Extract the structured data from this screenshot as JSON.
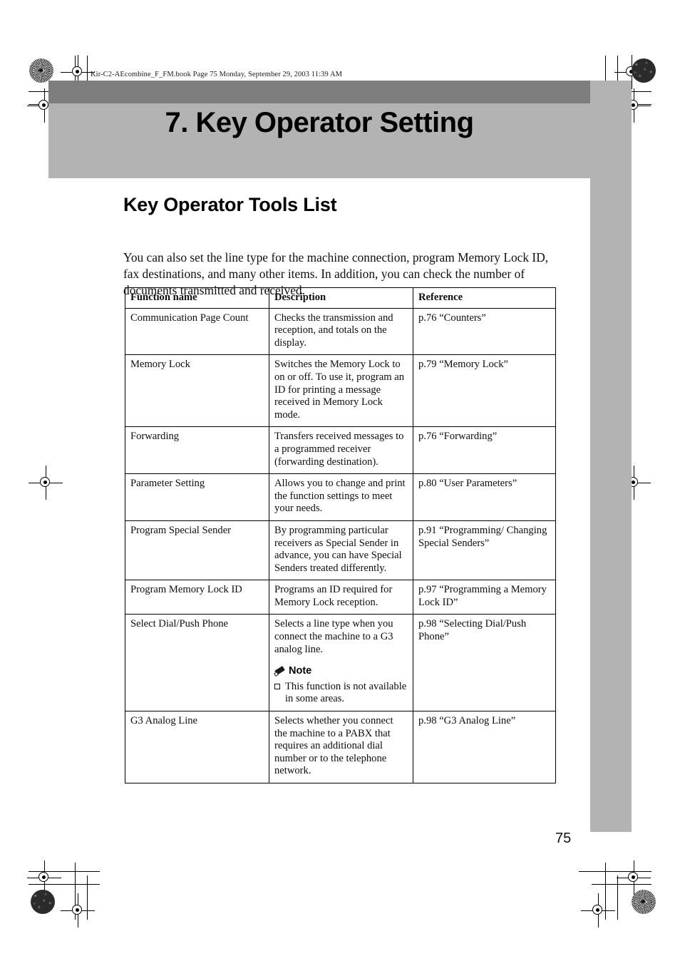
{
  "document": {
    "file_header": "Kir-C2-AEcombine_F_FM.book  Page 75  Monday, September 29, 2003  11:39 AM",
    "chapter_title": "7. Key Operator Setting",
    "section_title": "Key Operator Tools List",
    "intro_paragraph": "You can also set the line type for the machine connection, program Memory Lock ID, fax destinations, and many other items. In addition, you can check the number of documents transmitted and received.",
    "page_number": "75"
  },
  "table": {
    "headers": {
      "function_name": "Function name",
      "description": "Description",
      "reference": "Reference"
    },
    "rows": [
      {
        "function_name": "Communication Page Count",
        "description": "Checks the transmission and reception, and totals on the display.",
        "reference": "p.76 “Counters”"
      },
      {
        "function_name": "Memory Lock",
        "description": "Switches the Memory Lock to on or off. To use it, program an ID for printing a message received in Memory Lock mode.",
        "reference": "p.79 “Memory Lock”"
      },
      {
        "function_name": "Forwarding",
        "description": "Transfers received messages to a programmed receiver (forwarding destination).",
        "reference": "p.76 “Forwarding”"
      },
      {
        "function_name": "Parameter Setting",
        "description": "Allows you to change and print the function settings to meet your needs.",
        "reference": "p.80 “User Parameters”"
      },
      {
        "function_name": "Program Special Sender",
        "description": "By programming particular receivers as Special Sender in advance, you can have Special Senders treated differently.",
        "reference": "p.91 “Programming/ Changing Special Senders”"
      },
      {
        "function_name": "Program Memory Lock ID",
        "description": "Programs an ID required for Memory Lock reception.",
        "reference": "p.97 “Programming a Memory Lock ID”"
      },
      {
        "function_name": "Select Dial/Push Phone",
        "description": "Selects a line type when you connect the machine to a G3 analog line.",
        "note_label": "Note",
        "note_items": [
          "This function is not available in some areas."
        ],
        "reference": "p.98 “Selecting Dial/Push Phone”"
      },
      {
        "function_name": "G3 Analog Line",
        "description": "Selects whether you connect the machine to a PABX that requires an additional dial number or to the telephone network.",
        "reference": "p.98 “G3 Analog Line”"
      }
    ]
  },
  "colors": {
    "band_dark": "#7d7d7d",
    "band_light": "#b3b3b3",
    "text": "#0d0d0d",
    "page_background": "#ffffff"
  }
}
